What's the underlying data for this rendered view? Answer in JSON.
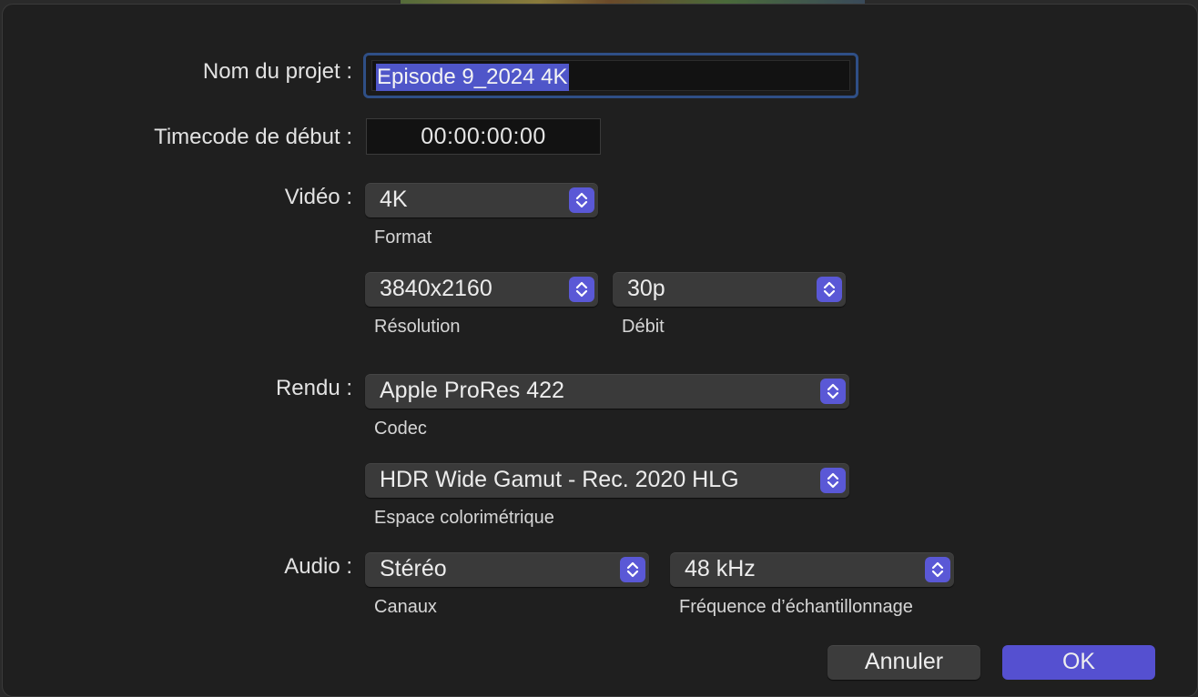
{
  "project": {
    "name_label": "Nom du projet :",
    "name_value": "Episode 9_2024 4K",
    "timecode_label": "Timecode de début :",
    "timecode_value": "00:00:00:00"
  },
  "video": {
    "label": "Vidéo :",
    "format_value": "4K",
    "format_caption": "Format",
    "resolution_value": "3840x2160",
    "resolution_caption": "Résolution",
    "rate_value": "30p",
    "rate_caption": "Débit"
  },
  "render": {
    "label": "Rendu :",
    "codec_value": "Apple ProRes 422",
    "codec_caption": "Codec",
    "colorspace_value": "HDR Wide Gamut - Rec. 2020 HLG",
    "colorspace_caption": "Espace colorimétrique"
  },
  "audio": {
    "label": "Audio :",
    "channels_value": "Stéréo",
    "channels_caption": "Canaux",
    "samplerate_value": "48 kHz",
    "samplerate_caption": "Fréquence d’échantillonnage"
  },
  "buttons": {
    "cancel_label": "Annuler",
    "ok_label": "OK"
  },
  "colors": {
    "accent": "#5550d0",
    "selection": "#4f56c9",
    "dialog_bg": "#1f1f1f",
    "control_bg": "#3a3a3a"
  },
  "icons": {
    "popup_indicator": "chevron-up-down-icon"
  }
}
